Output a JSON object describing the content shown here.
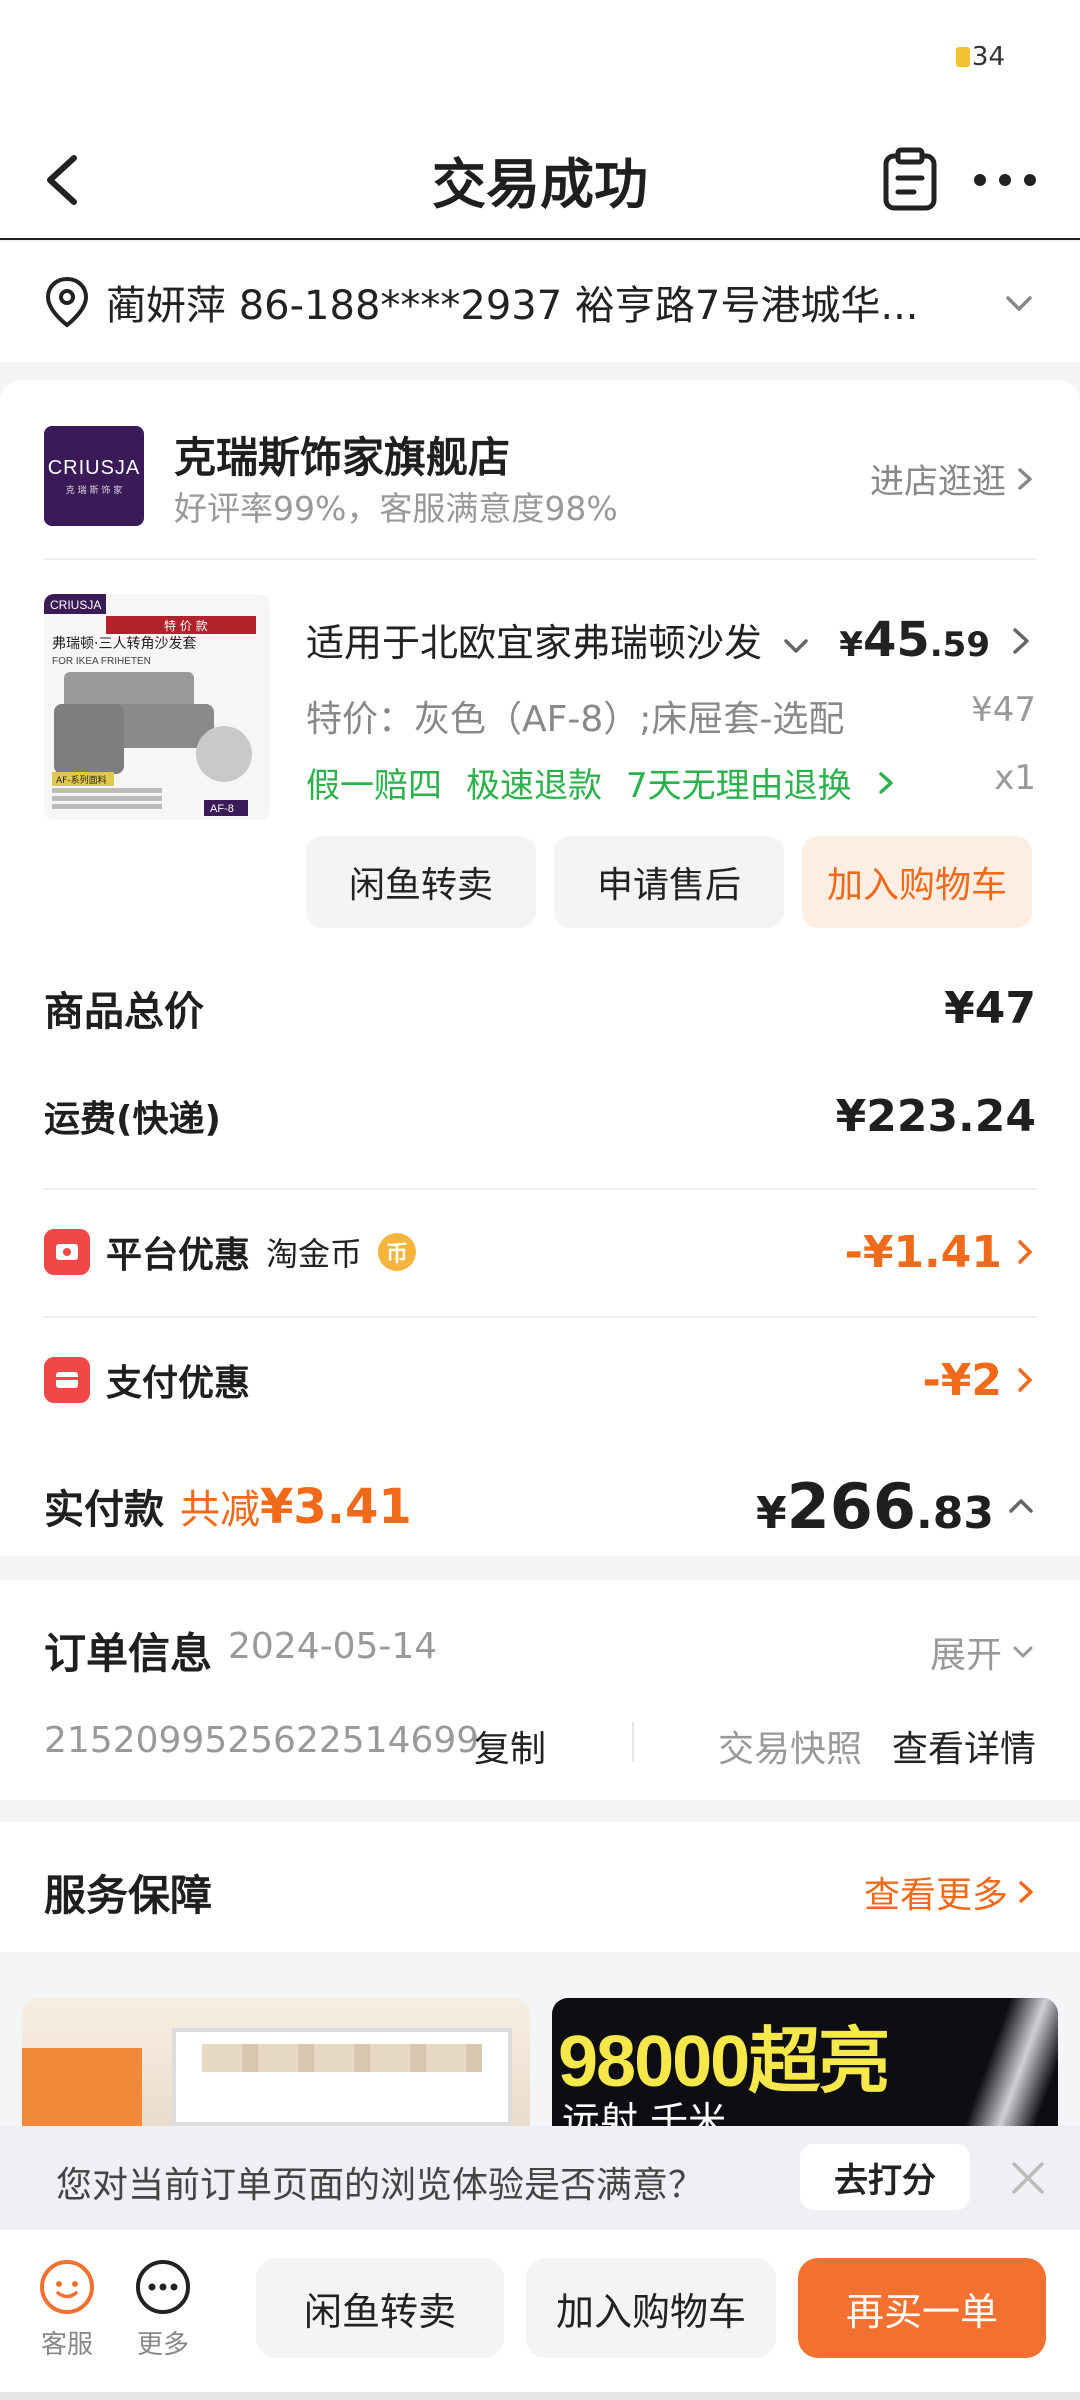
{
  "status": {
    "badge": "34"
  },
  "header": {
    "title": "交易成功"
  },
  "address": {
    "text": "蔺妍萍  86-188****2937  裕亨路7号港城华..."
  },
  "store": {
    "logo_text": "CRIUSJA",
    "logo_sub": "克 瑞 斯 饰 家",
    "name": "克瑞斯饰家旗舰店",
    "rating": "好评率99%，客服满意度98%",
    "visit": "进店逛逛"
  },
  "product": {
    "title": "适用于北欧宜家弗瑞顿沙发",
    "price_currency": "¥",
    "price_int": "45",
    "price_dec": ".59",
    "spec": "特价：灰色（AF-8）;床屉套-选配",
    "original_price": "¥47",
    "promises": [
      "假一赔四",
      "极速退款",
      "7天无理由退换"
    ],
    "qty": "x1",
    "image": {
      "brand": "CRIUSJA",
      "tag": "特 价 款",
      "caption": "弗瑞顿·三人转角沙发套",
      "caption_en": "FOR IKEA FRIHETEN",
      "series": "AF-系列面料",
      "code": "AF-8"
    }
  },
  "actions": {
    "resell": "闲鱼转卖",
    "after_sale": "申请售后",
    "add_cart": "加入购物车"
  },
  "summary": {
    "goods_label": "商品总价",
    "goods_value": "¥47",
    "shipping_label": "运费(快递)",
    "shipping_value": "¥223.24",
    "platform_label": "平台优惠",
    "platform_sub": "淘金币",
    "platform_value": "-¥1.41",
    "pay_label": "支付优惠",
    "pay_value": "-¥2",
    "paid_label": "实付款",
    "saved_prefix": "共减",
    "saved_value": "¥3.41",
    "paid_currency": "¥",
    "paid_int": "266",
    "paid_dec": ".83"
  },
  "order_info": {
    "title": "订单信息",
    "date": "2024-05-14",
    "expand": "展开",
    "order_no": "2152099525622514699",
    "copy": "复制",
    "snapshot": "交易快照",
    "detail": "查看详情"
  },
  "service": {
    "title": "服务保障",
    "more": "查看更多"
  },
  "banner": {
    "right_text": "98000超亮",
    "right_sub": "远射 千米"
  },
  "survey": {
    "question": "您对当前订单页面的浏览体验是否满意？",
    "button": "去打分"
  },
  "bottom": {
    "service": "客服",
    "more": "更多",
    "resell": "闲鱼转卖",
    "add_cart": "加入购物车",
    "rebuy": "再买一单"
  },
  "colors": {
    "accent": "#f06a1a",
    "green": "#2bb24c",
    "red_icon": "#f04848"
  }
}
